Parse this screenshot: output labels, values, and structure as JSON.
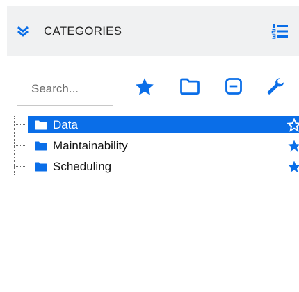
{
  "header": {
    "title": "CATEGORIES",
    "icons": {
      "collapse": "double-chevron-down-icon",
      "order": "ordered-list-icon"
    }
  },
  "search": {
    "placeholder": "Search...",
    "value": ""
  },
  "toolbar": {
    "icons": [
      "star-icon",
      "folder-icon",
      "collapse-all-icon",
      "wrench-icon"
    ]
  },
  "tree": {
    "items": [
      {
        "label": "Data",
        "selected": true,
        "icon": "folder-icon",
        "favorite": "star-icon"
      },
      {
        "label": "Maintainability",
        "selected": false,
        "icon": "folder-icon",
        "favorite": "star-icon"
      },
      {
        "label": "Scheduling",
        "selected": false,
        "icon": "folder-icon",
        "favorite": "star-icon"
      }
    ]
  },
  "colors": {
    "accent": "#0a6ee8",
    "header_bg": "#f0f1f2",
    "icon_blue": "#0a6ee8"
  }
}
